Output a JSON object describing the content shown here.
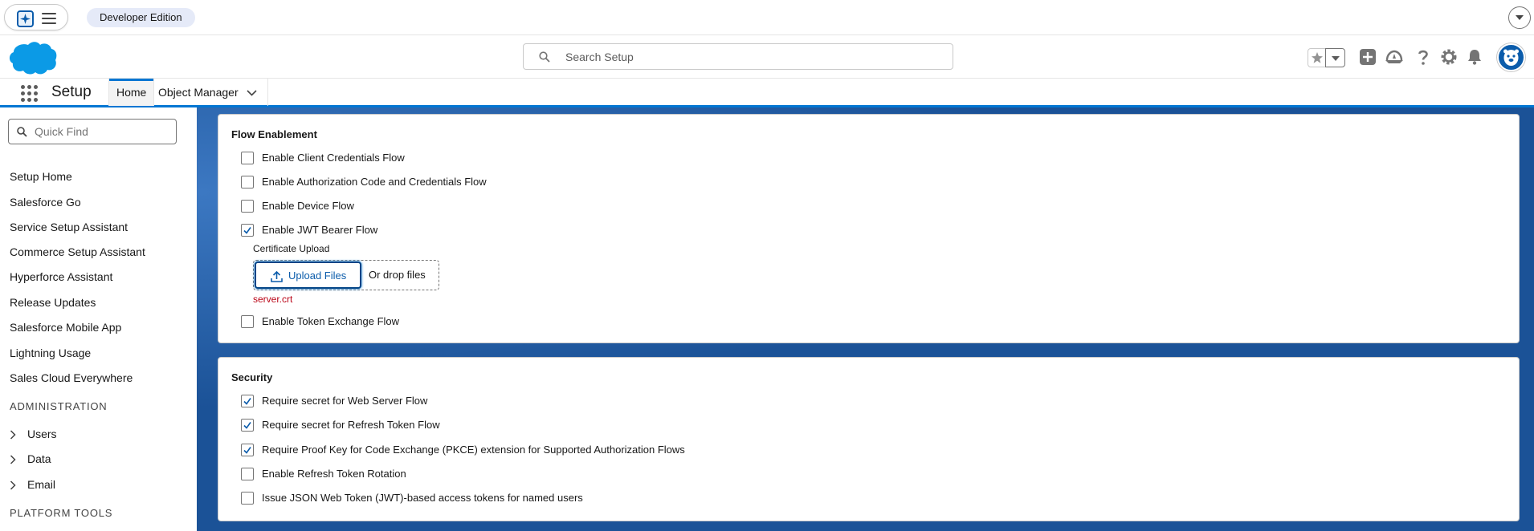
{
  "topbar": {
    "edition_badge": "Developer Edition"
  },
  "header": {
    "search_placeholder": "Search Setup"
  },
  "nav": {
    "app_name": "Setup",
    "tabs": [
      {
        "label": "Home"
      },
      {
        "label": "Object Manager"
      }
    ]
  },
  "sidebar": {
    "quickfind_placeholder": "Quick Find",
    "links": [
      "Setup Home",
      "Salesforce Go",
      "Service Setup Assistant",
      "Commerce Setup Assistant",
      "Hyperforce Assistant",
      "Release Updates",
      "Salesforce Mobile App",
      "Lightning Usage",
      "Sales Cloud Everywhere"
    ],
    "section_admin": "ADMINISTRATION",
    "admin_items": [
      "Users",
      "Data",
      "Email"
    ],
    "section_platform": "PLATFORM TOOLS"
  },
  "flow_enablement": {
    "title": "Flow Enablement",
    "options": [
      {
        "label": "Enable Client Credentials Flow",
        "checked": false
      },
      {
        "label": "Enable Authorization Code and Credentials Flow",
        "checked": false
      },
      {
        "label": "Enable Device Flow",
        "checked": false
      },
      {
        "label": "Enable JWT Bearer Flow",
        "checked": true
      }
    ],
    "cert_upload_label": "Certificate Upload",
    "upload_button": "Upload Files",
    "drop_text": "Or drop files",
    "file_name": "server.crt",
    "token_exchange": {
      "label": "Enable Token Exchange Flow",
      "checked": false
    }
  },
  "security": {
    "title": "Security",
    "options": [
      {
        "label": "Require secret for Web Server Flow",
        "checked": true
      },
      {
        "label": "Require secret for Refresh Token Flow",
        "checked": true
      },
      {
        "label": "Require Proof Key for Code Exchange (PKCE) extension for Supported Authorization Flows",
        "checked": true
      },
      {
        "label": "Enable Refresh Token Rotation",
        "checked": false
      },
      {
        "label": "Issue JSON Web Token (JWT)-based access tokens for named users",
        "checked": false
      }
    ]
  },
  "colors": {
    "brand_blue": "#0176d3",
    "checkmark": "#0b5cab",
    "error_red": "#ba0517"
  }
}
